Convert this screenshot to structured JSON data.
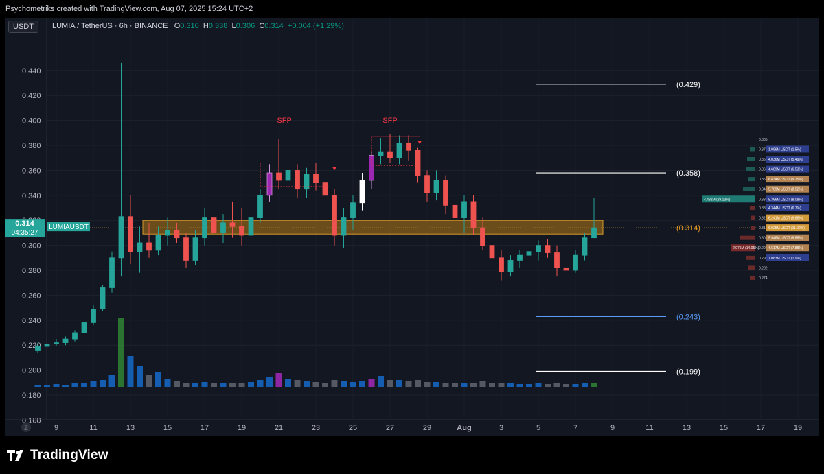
{
  "header": {
    "credit": "Psychometriks created with TradingView.com, Aug 07, 2025 15:24 UTC+2"
  },
  "legend": {
    "currency_chip": "USDT",
    "symbol": "LUMIA / TetherUS · 6h · BINANCE",
    "open_label": "O",
    "open": "0.310",
    "high_label": "H",
    "high": "0.338",
    "low_label": "L",
    "low": "0.306",
    "close_label": "C",
    "close": "0.314",
    "change": "+0.004 (+1.29%)"
  },
  "price_axis_ticks": [
    "0.440",
    "0.420",
    "0.400",
    "0.380",
    "0.360",
    "0.340",
    "0.320",
    "0.300",
    "0.280",
    "0.260",
    "0.240",
    "0.220",
    "0.200",
    "0.180",
    "0.160"
  ],
  "time_axis_ticks": [
    "9",
    "11",
    "13",
    "15",
    "17",
    "19",
    "21",
    "23",
    "25",
    "27",
    "29",
    "Aug",
    "3",
    "5",
    "7",
    "9",
    "11",
    "13",
    "15",
    "17",
    "19"
  ],
  "time_axis_button": "Z",
  "last_price": {
    "symbol_tag": "LUMIAUSDT",
    "price": "0.314",
    "countdown": "04:35:27"
  },
  "levels": [
    {
      "value": 0.429,
      "label": "(0.429)",
      "color": "#ffffff"
    },
    {
      "value": 0.358,
      "label": "(0.358)",
      "color": "#ffffff"
    },
    {
      "value": 0.314,
      "label": "(0.314)",
      "color": "#f0a020"
    },
    {
      "value": 0.243,
      "label": "(0.243)",
      "color": "#5b9cf6"
    },
    {
      "value": 0.199,
      "label": "(0.199)",
      "color": "#ffffff"
    }
  ],
  "annotations": [
    {
      "text": "SFP",
      "color": "#f23645"
    },
    {
      "text": "SFP",
      "color": "#f23645"
    }
  ],
  "order_book": {
    "price_levels": [
      "0.385",
      "0.377",
      "0.369",
      "0.361",
      "0.353",
      "0.345",
      "0.337",
      "0.330",
      "0.322",
      "0.314",
      "0.306",
      "0.298",
      "0.290",
      "0.282",
      "0.274"
    ],
    "ask_volumes": [
      "",
      "1.096M USDT (1.5%)",
      "4.036M USDT (5.49%)",
      "4.689M USDT (6.53%)",
      "6.434M USDT (9.25%)",
      "5.789M USDT (8.52%)",
      "5.366M USDT (8.08%)",
      "4.344M USDT (6.7%)",
      "6.241M USDT (9.86%)",
      "6.925M USDT (11.22%)",
      "5.946M USDT (9.88%)",
      "4.617M USDT (7.88%)",
      "1.083M USDT (1.9%)",
      "",
      ""
    ],
    "bid_volumes": [
      "",
      "",
      "",
      "",
      "",
      "",
      "4.432M (29.13%)",
      "",
      "",
      "",
      "",
      "2.075M (14.05%)",
      "",
      "",
      ""
    ],
    "highlight": "4.432M (29.13%)"
  },
  "logo": {
    "text": "TradingView"
  },
  "chart_data": {
    "type": "candlestick",
    "symbol": "LUMIA / TetherUS",
    "interval": "6h",
    "exchange": "BINANCE",
    "ylim": [
      0.15,
      0.45
    ],
    "grid": true,
    "x_axis": [
      "9",
      "11",
      "13",
      "15",
      "17",
      "19",
      "21",
      "23",
      "25",
      "27",
      "29",
      "Aug",
      "3",
      "5",
      "7",
      "9",
      "11",
      "13",
      "15",
      "17",
      "19"
    ],
    "candles": [
      {
        "day": 8.0,
        "o": 0.216,
        "h": 0.222,
        "l": 0.214,
        "c": 0.219
      },
      {
        "day": 8.5,
        "o": 0.219,
        "h": 0.223,
        "l": 0.217,
        "c": 0.221
      },
      {
        "day": 9.0,
        "o": 0.221,
        "h": 0.225,
        "l": 0.219,
        "c": 0.222
      },
      {
        "day": 9.5,
        "o": 0.222,
        "h": 0.227,
        "l": 0.22,
        "c": 0.225
      },
      {
        "day": 10.0,
        "o": 0.225,
        "h": 0.232,
        "l": 0.223,
        "c": 0.23
      },
      {
        "day": 10.5,
        "o": 0.23,
        "h": 0.24,
        "l": 0.228,
        "c": 0.238
      },
      {
        "day": 11.0,
        "o": 0.238,
        "h": 0.252,
        "l": 0.236,
        "c": 0.249
      },
      {
        "day": 11.5,
        "o": 0.249,
        "h": 0.268,
        "l": 0.247,
        "c": 0.266
      },
      {
        "day": 12.0,
        "o": 0.266,
        "h": 0.295,
        "l": 0.262,
        "c": 0.29
      },
      {
        "day": 12.5,
        "o": 0.29,
        "h": 0.446,
        "l": 0.275,
        "c": 0.323
      },
      {
        "day": 13.0,
        "o": 0.323,
        "h": 0.34,
        "l": 0.285,
        "c": 0.295
      },
      {
        "day": 13.5,
        "o": 0.295,
        "h": 0.315,
        "l": 0.278,
        "c": 0.302
      },
      {
        "day": 14.0,
        "o": 0.302,
        "h": 0.318,
        "l": 0.29,
        "c": 0.296
      },
      {
        "day": 14.5,
        "o": 0.296,
        "h": 0.315,
        "l": 0.292,
        "c": 0.308
      },
      {
        "day": 15.0,
        "o": 0.308,
        "h": 0.322,
        "l": 0.3,
        "c": 0.312
      },
      {
        "day": 15.5,
        "o": 0.312,
        "h": 0.318,
        "l": 0.302,
        "c": 0.306
      },
      {
        "day": 16.0,
        "o": 0.306,
        "h": 0.31,
        "l": 0.282,
        "c": 0.288
      },
      {
        "day": 16.5,
        "o": 0.288,
        "h": 0.312,
        "l": 0.284,
        "c": 0.306
      },
      {
        "day": 17.0,
        "o": 0.306,
        "h": 0.33,
        "l": 0.3,
        "c": 0.322
      },
      {
        "day": 17.5,
        "o": 0.322,
        "h": 0.328,
        "l": 0.305,
        "c": 0.31
      },
      {
        "day": 18.0,
        "o": 0.31,
        "h": 0.325,
        "l": 0.302,
        "c": 0.318
      },
      {
        "day": 18.5,
        "o": 0.318,
        "h": 0.335,
        "l": 0.306,
        "c": 0.315
      },
      {
        "day": 19.0,
        "o": 0.315,
        "h": 0.33,
        "l": 0.3,
        "c": 0.308
      },
      {
        "day": 19.5,
        "o": 0.308,
        "h": 0.325,
        "l": 0.3,
        "c": 0.322
      },
      {
        "day": 20.0,
        "o": 0.322,
        "h": 0.345,
        "l": 0.318,
        "c": 0.34
      },
      {
        "day": 20.5,
        "o": 0.34,
        "h": 0.365,
        "l": 0.335,
        "c": 0.358
      },
      {
        "day": 21.0,
        "o": 0.358,
        "h": 0.385,
        "l": 0.345,
        "c": 0.352
      },
      {
        "day": 21.5,
        "o": 0.352,
        "h": 0.366,
        "l": 0.34,
        "c": 0.36
      },
      {
        "day": 22.0,
        "o": 0.36,
        "h": 0.365,
        "l": 0.338,
        "c": 0.345
      },
      {
        "day": 22.5,
        "o": 0.345,
        "h": 0.362,
        "l": 0.338,
        "c": 0.357
      },
      {
        "day": 23.0,
        "o": 0.357,
        "h": 0.366,
        "l": 0.344,
        "c": 0.35
      },
      {
        "day": 23.5,
        "o": 0.35,
        "h": 0.36,
        "l": 0.335,
        "c": 0.34
      },
      {
        "day": 24.0,
        "o": 0.34,
        "h": 0.345,
        "l": 0.3,
        "c": 0.308
      },
      {
        "day": 24.5,
        "o": 0.308,
        "h": 0.33,
        "l": 0.298,
        "c": 0.322
      },
      {
        "day": 25.0,
        "o": 0.322,
        "h": 0.34,
        "l": 0.312,
        "c": 0.334
      },
      {
        "day": 25.5,
        "o": 0.334,
        "h": 0.358,
        "l": 0.328,
        "c": 0.352
      },
      {
        "day": 26.0,
        "o": 0.352,
        "h": 0.375,
        "l": 0.345,
        "c": 0.372
      },
      {
        "day": 26.5,
        "o": 0.372,
        "h": 0.386,
        "l": 0.365,
        "c": 0.375
      },
      {
        "day": 27.0,
        "o": 0.375,
        "h": 0.389,
        "l": 0.366,
        "c": 0.37
      },
      {
        "day": 27.5,
        "o": 0.37,
        "h": 0.388,
        "l": 0.365,
        "c": 0.382
      },
      {
        "day": 28.0,
        "o": 0.382,
        "h": 0.388,
        "l": 0.368,
        "c": 0.376
      },
      {
        "day": 28.5,
        "o": 0.376,
        "h": 0.378,
        "l": 0.35,
        "c": 0.356
      },
      {
        "day": 29.0,
        "o": 0.356,
        "h": 0.36,
        "l": 0.335,
        "c": 0.342
      },
      {
        "day": 29.5,
        "o": 0.342,
        "h": 0.36,
        "l": 0.336,
        "c": 0.352
      },
      {
        "day": 30.0,
        "o": 0.352,
        "h": 0.356,
        "l": 0.325,
        "c": 0.332
      },
      {
        "day": 30.5,
        "o": 0.332,
        "h": 0.342,
        "l": 0.315,
        "c": 0.322
      },
      {
        "day": 31.0,
        "o": 0.322,
        "h": 0.34,
        "l": 0.31,
        "c": 0.335
      },
      {
        "day": 31.5,
        "o": 0.335,
        "h": 0.34,
        "l": 0.308,
        "c": 0.314
      },
      {
        "day": 32.0,
        "o": 0.314,
        "h": 0.322,
        "l": 0.296,
        "c": 0.3
      },
      {
        "day": 32.5,
        "o": 0.3,
        "h": 0.304,
        "l": 0.285,
        "c": 0.29
      },
      {
        "day": 33.0,
        "o": 0.29,
        "h": 0.296,
        "l": 0.272,
        "c": 0.279
      },
      {
        "day": 33.5,
        "o": 0.279,
        "h": 0.292,
        "l": 0.275,
        "c": 0.288
      },
      {
        "day": 34.0,
        "o": 0.288,
        "h": 0.296,
        "l": 0.282,
        "c": 0.292
      },
      {
        "day": 34.5,
        "o": 0.292,
        "h": 0.3,
        "l": 0.285,
        "c": 0.295
      },
      {
        "day": 35.0,
        "o": 0.295,
        "h": 0.304,
        "l": 0.288,
        "c": 0.3
      },
      {
        "day": 35.5,
        "o": 0.3,
        "h": 0.305,
        "l": 0.29,
        "c": 0.294
      },
      {
        "day": 36.0,
        "o": 0.294,
        "h": 0.3,
        "l": 0.275,
        "c": 0.282
      },
      {
        "day": 36.5,
        "o": 0.282,
        "h": 0.29,
        "l": 0.274,
        "c": 0.28
      },
      {
        "day": 37.0,
        "o": 0.28,
        "h": 0.296,
        "l": 0.278,
        "c": 0.292
      },
      {
        "day": 37.5,
        "o": 0.292,
        "h": 0.31,
        "l": 0.288,
        "c": 0.306
      },
      {
        "day": 38.0,
        "o": 0.306,
        "h": 0.338,
        "l": 0.306,
        "c": 0.314
      }
    ],
    "volume_relative": [
      0.03,
      0.03,
      0.04,
      0.03,
      0.05,
      0.06,
      0.08,
      0.1,
      0.18,
      1.0,
      0.45,
      0.3,
      0.18,
      0.22,
      0.12,
      0.08,
      0.06,
      0.06,
      0.07,
      0.06,
      0.06,
      0.05,
      0.06,
      0.07,
      0.1,
      0.15,
      0.2,
      0.12,
      0.1,
      0.08,
      0.07,
      0.06,
      0.1,
      0.08,
      0.07,
      0.08,
      0.12,
      0.16,
      0.1,
      0.1,
      0.08,
      0.1,
      0.07,
      0.07,
      0.06,
      0.06,
      0.06,
      0.06,
      0.08,
      0.05,
      0.05,
      0.06,
      0.04,
      0.04,
      0.05,
      0.04,
      0.05,
      0.04,
      0.04,
      0.05,
      0.06,
      0.08,
      0.15
    ]
  }
}
